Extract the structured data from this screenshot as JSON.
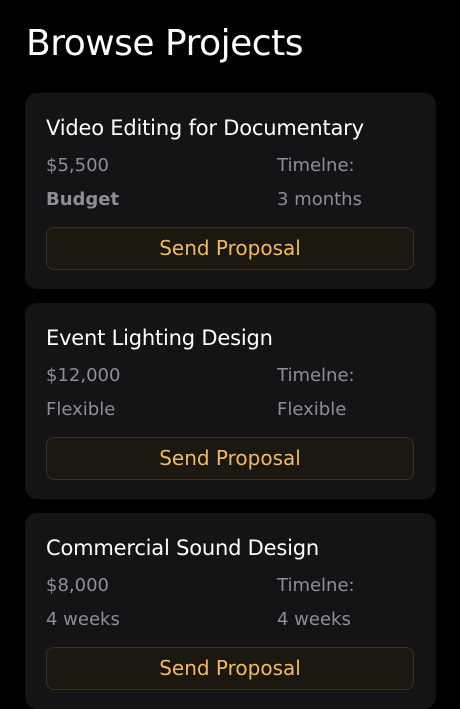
{
  "header": {
    "title": "Browse Projects"
  },
  "theme": {
    "background": "#000000",
    "card_background": "#141416",
    "accent": "#f5b860",
    "muted_text": "#8e8e93"
  },
  "projects": [
    {
      "title": "Video Editing for Documentary",
      "budget": "$5,500",
      "budget_label": "Budget",
      "timeline_label": "Timelne:",
      "timeline": "3 months",
      "button_label": "Send Proposal"
    },
    {
      "title": "Event Lighting Design",
      "budget": "$12,000",
      "budget_label": "Flexible",
      "timeline_label": "Timelne:",
      "timeline": "Flexible",
      "button_label": "Send Proposal"
    },
    {
      "title": "Commercial Sound Design",
      "budget": "$8,000",
      "budget_label": "4 weeks",
      "timeline_label": "Timelne:",
      "timeline": "4 weeks",
      "button_label": "Send Proposal"
    }
  ]
}
